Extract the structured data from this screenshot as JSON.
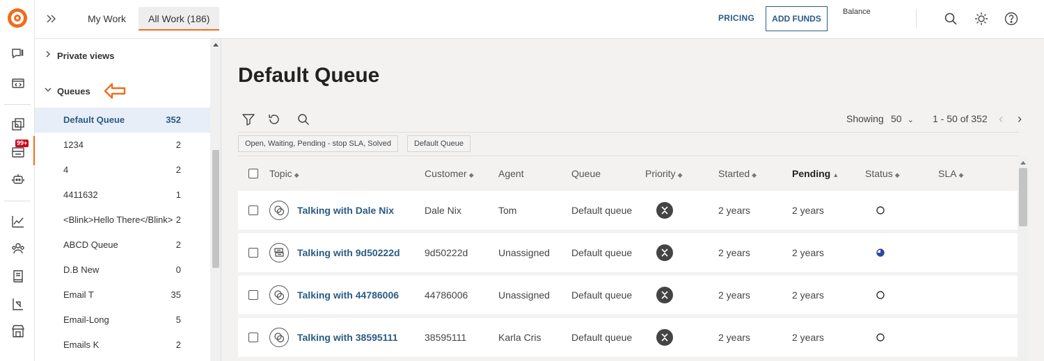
{
  "topbar": {
    "tabs": [
      {
        "label": "My Work"
      },
      {
        "label": "All Work (186)"
      }
    ],
    "pricing_label": "PRICING",
    "add_funds_label": "ADD FUNDS",
    "balance_label": "Balance"
  },
  "rail": {
    "badge": "99+"
  },
  "sidebar": {
    "private_views_label": "Private views",
    "queues_label": "Queues",
    "queues": [
      {
        "name": "Default Queue",
        "count": "352"
      },
      {
        "name": "1234",
        "count": "2"
      },
      {
        "name": "4",
        "count": "2"
      },
      {
        "name": "4411632",
        "count": "1"
      },
      {
        "name": "<Blink>Hello There</Blink>",
        "count": "2"
      },
      {
        "name": "ABCD Queue",
        "count": "2"
      },
      {
        "name": "D.B New",
        "count": "0"
      },
      {
        "name": "Email T",
        "count": "35"
      },
      {
        "name": "Email-Long",
        "count": "5"
      },
      {
        "name": "Emails K",
        "count": "2"
      }
    ]
  },
  "main": {
    "title": "Default Queue",
    "showing_label": "Showing",
    "page_size": "50",
    "range": "1 - 50 of 352",
    "chips": [
      {
        "label": "Open, Waiting, Pending - stop SLA, Solved"
      },
      {
        "label": "Default Queue"
      }
    ],
    "columns": {
      "topic": "Topic",
      "customer": "Customer",
      "agent": "Agent",
      "queue": "Queue",
      "priority": "Priority",
      "started": "Started",
      "pending": "Pending",
      "status": "Status",
      "sla": "SLA"
    },
    "rows": [
      {
        "topic": "Talking with Dale Nix",
        "customer": "Dale Nix",
        "agent": "Tom",
        "queue": "Default queue",
        "started": "2 years",
        "pending": "2 years",
        "status": "open"
      },
      {
        "topic": "Talking with 9d50222d",
        "customer": "9d50222d",
        "agent": "Unassigned",
        "queue": "Default queue",
        "started": "2 years",
        "pending": "2 years",
        "status": "pending"
      },
      {
        "topic": "Talking with 44786006",
        "customer": "44786006",
        "agent": "Unassigned",
        "queue": "Default queue",
        "started": "2 years",
        "pending": "2 years",
        "status": "open"
      },
      {
        "topic": "Talking with 38595111",
        "customer": "38595111",
        "agent": "Karla Cris",
        "queue": "Default queue",
        "started": "2 years",
        "pending": "2 years",
        "status": "open"
      }
    ]
  },
  "colors": {
    "brand": "#f26b1d",
    "link": "#2b5b84",
    "selected_bg": "#e8eef8",
    "badge": "#d0021b"
  }
}
